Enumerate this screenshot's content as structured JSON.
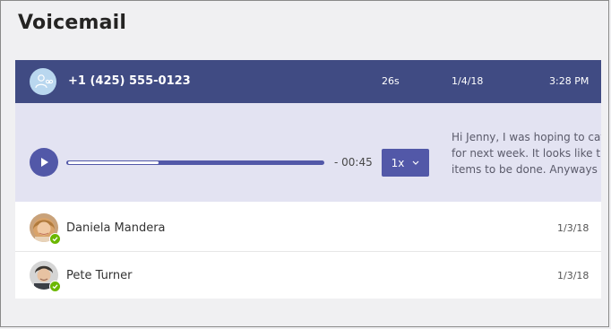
{
  "page": {
    "title": "Voicemail"
  },
  "colors": {
    "header_bg": "#404b83",
    "player_bg": "#e3e3f2",
    "accent": "#5258a8",
    "presence_available": "#6bb700"
  },
  "active_voicemail": {
    "icon": "voicemail-caller-icon",
    "number": "+1 (425) 555-0123",
    "duration": "26s",
    "date": "1/4/18",
    "time": "3:28 PM",
    "player": {
      "play_icon": "play-icon",
      "progress_fraction": 0.35,
      "remaining": "- 00:45",
      "speed": "1x",
      "speed_icon": "chevron-down-icon"
    },
    "transcript_lines": [
      "Hi Jenny, I was hoping to catc",
      "for next week. It looks like the",
      "items to be done. Anyways g"
    ]
  },
  "voicemails": [
    {
      "name": "Daniela Mandera",
      "date": "1/3/18",
      "presence": "available"
    },
    {
      "name": "Pete Turner",
      "date": "1/3/18",
      "presence": "available"
    }
  ]
}
